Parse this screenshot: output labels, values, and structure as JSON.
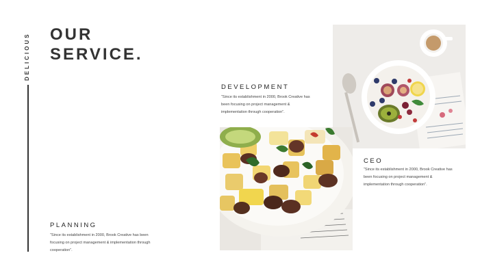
{
  "side_label": "DELICIOUS",
  "title": {
    "line1": "OUR",
    "line2": "SERVICE."
  },
  "development": {
    "heading": "DEVELOPMENT",
    "text_lines": [
      "“Since its establishment in 2000, Brook Creative has",
      "been focusing on project management &",
      "implementation through cooperation”."
    ]
  },
  "ceo": {
    "heading": "CEO",
    "text_lines": [
      "“Since its establishment in 2000, Brook Creative has",
      "been focusing on project management &",
      "implementation through cooperation”."
    ]
  },
  "planning": {
    "heading": "PLANNING",
    "text_lines": [
      "“Since its establishment in 2000, Brook Creative has been",
      "focusing on project management & implementation through",
      "cooperation”."
    ]
  },
  "colors": {
    "text": "#333333",
    "background": "#ffffff",
    "accent_line": "#333333"
  }
}
